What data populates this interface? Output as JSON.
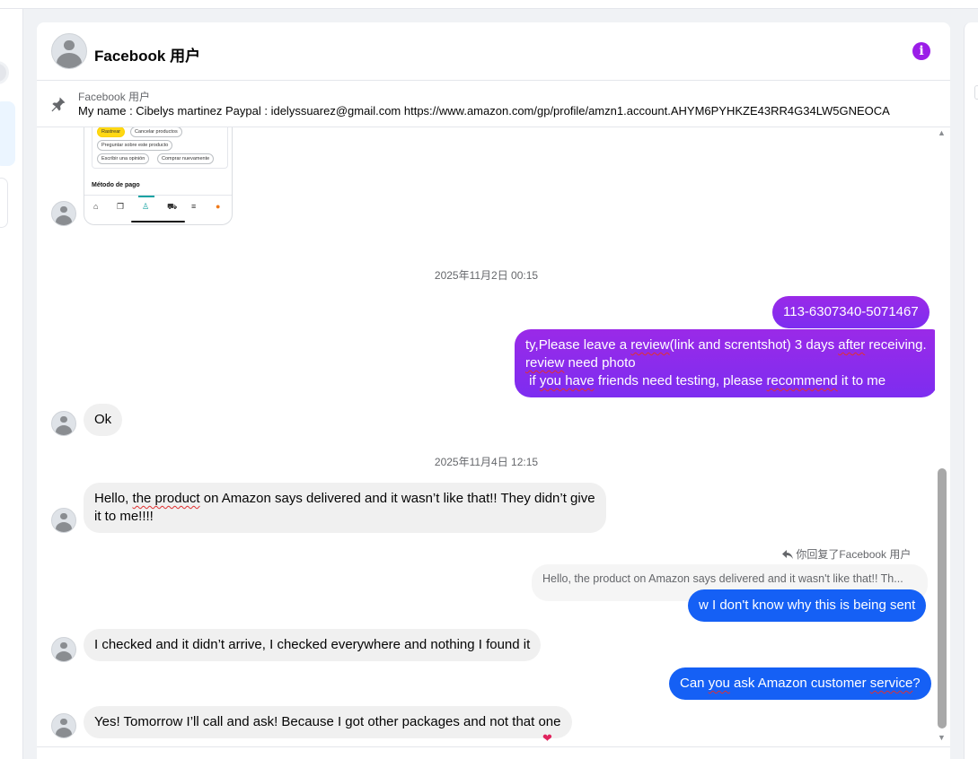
{
  "header": {
    "title": "Facebook 用户",
    "info_icon": "info-icon",
    "accent_color": "#9b1de8"
  },
  "pinned": {
    "icon": "pin-icon",
    "from": "Facebook 用户",
    "text": "My name : Cibelys martinez Paypal : idelyssuarez@gmail.com https://www.amazon.com/gp/profile/amzn1.account.AHYM6PYHKZE43RR4G34LW5GNEOCA"
  },
  "image_attachment": {
    "chips": [
      "Rastrear",
      "Cancelar productos",
      "Preguntar sobre este producto",
      "Escribir una opinión",
      "Comprar nuevamente"
    ],
    "section": "Método de pago",
    "nav_icons": [
      "home-icon",
      "copy-icon",
      "account-icon",
      "cart-icon",
      "menu-icon",
      "apps-icon"
    ]
  },
  "messages": {
    "ts1": "2025年11月2日 00:15",
    "order_number": "113-6307340-5071467",
    "review_request": {
      "line1_a": "ty,Please leave a ",
      "line1_b": "review",
      "line1_c": "(link and screntshot) 3 days ",
      "line1_d": "after",
      "line1_e": " receiving.",
      "line2_a": "review",
      "line2_b": " need photo",
      "line3_a": " if ",
      "line3_b": "you have",
      "line3_c": " friends need testing, please ",
      "line3_d": "recommend",
      "line3_e": " it to me"
    },
    "ok": "Ok",
    "ts2": "2025年11月4日 12:15",
    "delivered": {
      "line1_a": "Hello, ",
      "line1_b": "the product",
      "line1_c": " on Amazon says delivered and it wasn’t like that!! They didn’t give",
      "line2": "it to me!!!!"
    },
    "reply_label": "你回复了Facebook 用户",
    "reply_icon": "reply-arrow-icon",
    "reply_quote": "Hello, the product on Amazon says delivered and it wasn't like that!! Th...",
    "dont_know": "w I don't know why this is being sent",
    "checked": "I checked and it didn’t arrive, I checked everywhere and nothing I found it",
    "customer_service": {
      "a": "Can ",
      "b": "you",
      "c": " ask Amazon customer ",
      "d": "service",
      "e": "?"
    },
    "tomorrow": "Yes! Tomorrow I’ll call and ask! Because I got other packages and not that one",
    "reaction": "❤"
  },
  "colors": {
    "outgoing_purple": "#8a2be8",
    "outgoing_blue": "#1560f5",
    "incoming_gray": "#f0f0f0",
    "reaction_red": "#e0245e"
  }
}
